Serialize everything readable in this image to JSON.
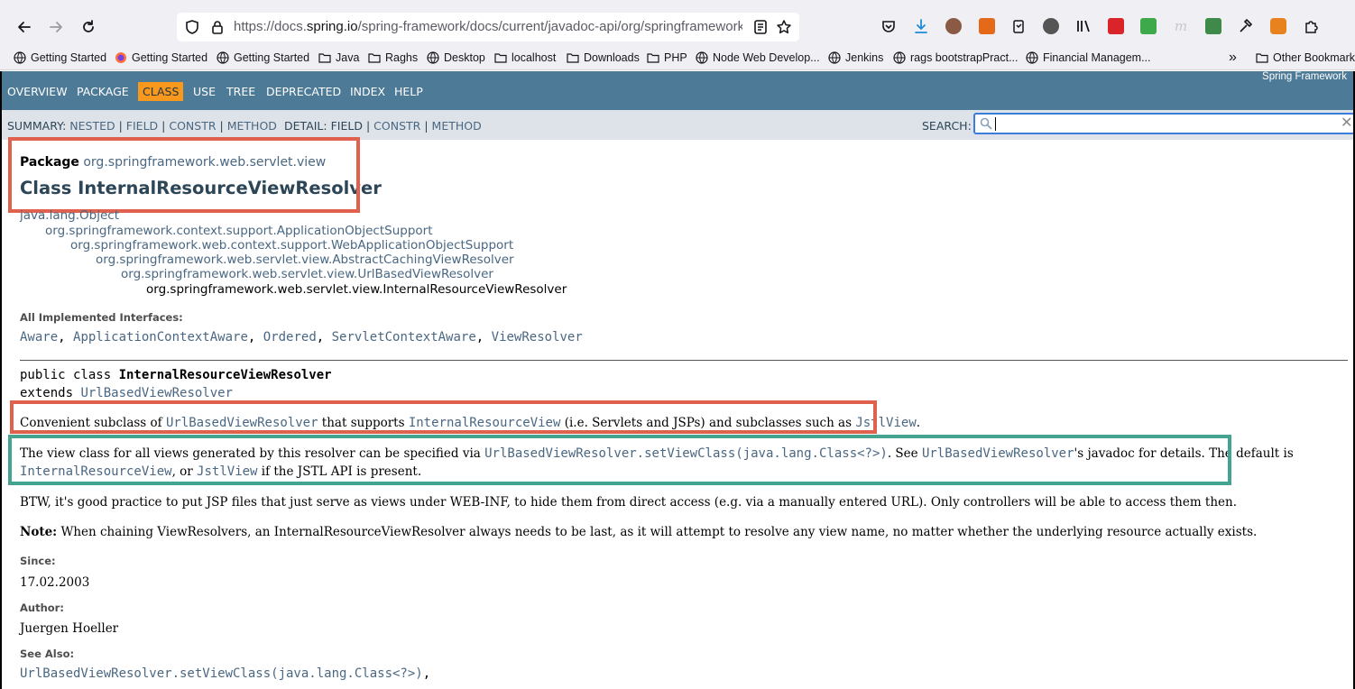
{
  "browser": {
    "url_prefix": "https://docs.",
    "url_domain": "spring.io",
    "url_path": "/spring-framework/docs/current/javadoc-api/org/springframework",
    "bookmarks": [
      "Getting Started",
      "Getting Started",
      "Getting Started",
      "Java",
      "Raghs",
      "Desktop",
      "localhost",
      "Downloads",
      "PHP",
      "Node Web Develop...",
      "Jenkins",
      "rags bootstrapPract...",
      "Financial Managem..."
    ],
    "other_bookmarks": "Other Bookmarks",
    "overflow": "»"
  },
  "javadoc": {
    "nav": [
      "OVERVIEW",
      "PACKAGE",
      "CLASS",
      "USE",
      "TREE",
      "DEPRECATED",
      "INDEX",
      "HELP"
    ],
    "active_nav": "CLASS",
    "brand": "Spring Framework",
    "summary_label": "SUMMARY:",
    "summary_links": [
      "NESTED",
      "FIELD",
      "CONSTR",
      "METHOD"
    ],
    "detail_label": "DETAIL:",
    "detail_items": [
      "FIELD",
      "CONSTR",
      "METHOD"
    ],
    "separator": "|",
    "search_label": "SEARCH:",
    "search_value": "",
    "search_reset": "✕"
  },
  "page": {
    "package_label": "Package",
    "package_name": "org.springframework.web.servlet.view",
    "class_title": "Class InternalResourceViewResolver",
    "hierarchy": [
      "java.lang.Object",
      "org.springframework.context.support.ApplicationObjectSupport",
      "org.springframework.web.context.support.WebApplicationObjectSupport",
      "org.springframework.web.servlet.view.AbstractCachingViewResolver",
      "org.springframework.web.servlet.view.UrlBasedViewResolver",
      "org.springframework.web.servlet.view.InternalResourceViewResolver"
    ],
    "interfaces_label": "All Implemented Interfaces:",
    "interfaces": [
      "Aware",
      "ApplicationContextAware",
      "Ordered",
      "ServletContextAware",
      "ViewResolver"
    ],
    "decl_prefix": "public class ",
    "decl_name": "InternalResourceViewResolver",
    "decl_extends": "extends ",
    "decl_super": "UrlBasedViewResolver",
    "desc1": {
      "t1": "Convenient subclass of ",
      "l1": "UrlBasedViewResolver",
      "t2": " that supports ",
      "l2": "InternalResourceView",
      "t3": " (i.e. Servlets and JSPs) and subclasses such as ",
      "l3": "JstlView",
      "t4": "."
    },
    "desc2": {
      "t1": "The view class for all views generated by this resolver can be specified via ",
      "l1": "UrlBasedViewResolver.setViewClass(java.lang.Class<?>)",
      "t2": ". See ",
      "l2": "UrlBasedViewResolver",
      "t3": "'s javadoc for details. The default is",
      "l3": "InternalResourceView",
      "t4": ", or ",
      "l4": "JstlView",
      "t5": " if the JSTL API is present."
    },
    "desc3": "BTW, it's good practice to put JSP files that just serve as views under WEB-INF, to hide them from direct access (e.g. via a manually entered URL). Only controllers will be able to access them then.",
    "note_label": "Note:",
    "note_text": " When chaining ViewResolvers, an InternalResourceViewResolver always needs to be last, as it will attempt to resolve any view name, no matter whether the underlying resource actually exists.",
    "since_label": "Since:",
    "since_value": "17.02.2003",
    "author_label": "Author:",
    "author_value": "Juergen Hoeller",
    "see_also_label": "See Also:",
    "see_also_link": "UrlBasedViewResolver.setViewClass(java.lang.Class<?>)",
    "see_also_sep": ","
  },
  "colors": {
    "nav_bg": "#4d7a97",
    "nav_active": "#f8981d",
    "subnav_bg": "#dee3e9",
    "link": "#4a6782",
    "highlight_red": "#e0614e",
    "highlight_teal": "#44a48f"
  }
}
